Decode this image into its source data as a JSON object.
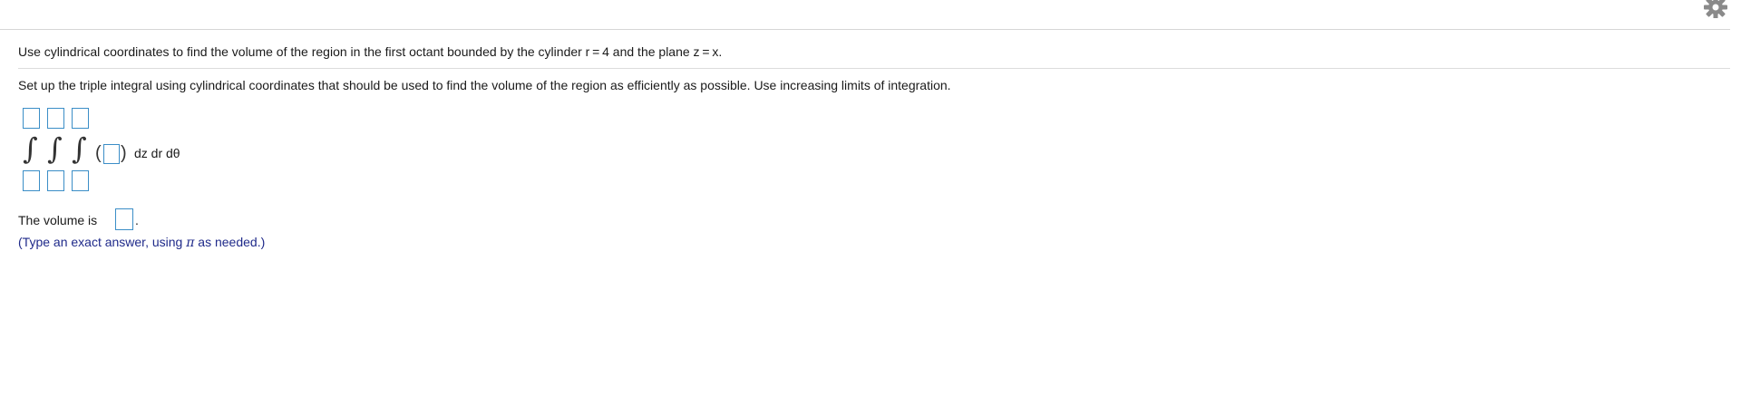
{
  "header": {
    "settings_icon": "gear-icon"
  },
  "question": {
    "prompt": "Use cylindrical coordinates to find the volume of the region in the first octant bounded by the cylinder r = 4 and the plane z = x."
  },
  "part1": {
    "instruction": "Set up the triple integral using cylindrical coordinates that should be used to find the volume of the region as efficiently as possible. Use increasing limits of integration.",
    "integral_symbol": "∫",
    "open_paren": "(",
    "close_paren": ")",
    "differentials": "dz dr dθ",
    "upper_limits": [
      "",
      "",
      ""
    ],
    "lower_limits": [
      "",
      "",
      ""
    ],
    "integrand": ""
  },
  "part2": {
    "label": "The volume is",
    "period": ".",
    "answer": "",
    "hint_prefix": "(Type an exact answer, using ",
    "hint_pi": "π",
    "hint_suffix": " as needed.)"
  },
  "colors": {
    "input_border": "#3b8ec7",
    "hint_text": "#1f2a8a",
    "divider": "#d6d6d6"
  }
}
